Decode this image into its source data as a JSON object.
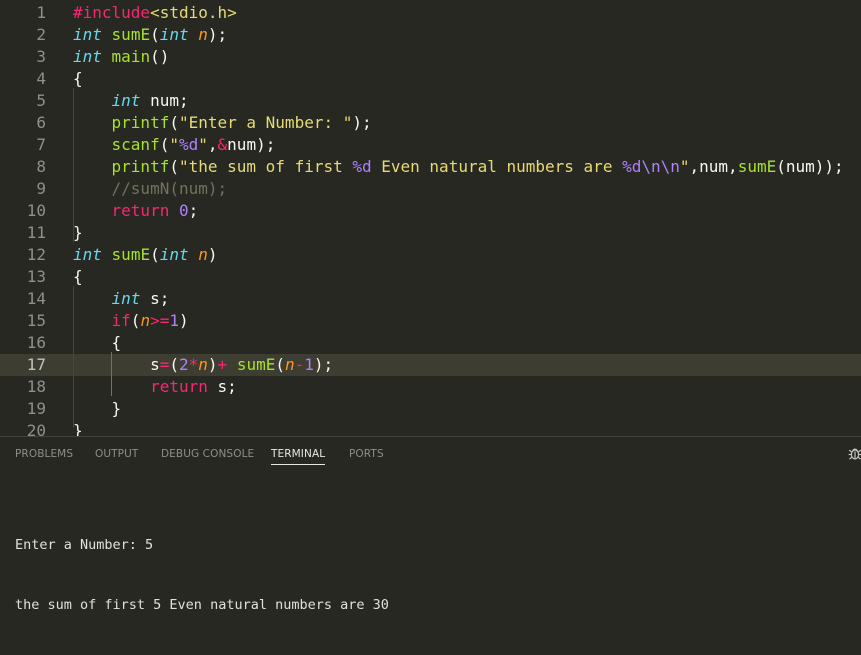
{
  "editor": {
    "active_line_number": "17",
    "lines": [
      {
        "n": "1",
        "tokens": [
          {
            "t": "#include",
            "c": "pp"
          },
          {
            "t": "<stdio.h>",
            "c": "hdr"
          }
        ]
      },
      {
        "n": "2",
        "tokens": [
          {
            "t": "int",
            "c": "type"
          },
          {
            "t": " "
          },
          {
            "t": "sumE",
            "c": "fn"
          },
          {
            "t": "("
          },
          {
            "t": "int",
            "c": "type"
          },
          {
            "t": " "
          },
          {
            "t": "n",
            "c": "param"
          },
          {
            "t": ");"
          }
        ]
      },
      {
        "n": "3",
        "tokens": [
          {
            "t": "int",
            "c": "type"
          },
          {
            "t": " "
          },
          {
            "t": "main",
            "c": "fn"
          },
          {
            "t": "()"
          }
        ]
      },
      {
        "n": "4",
        "tokens": [
          {
            "t": "{"
          }
        ]
      },
      {
        "n": "5",
        "tokens": [
          {
            "t": "    "
          },
          {
            "t": "int",
            "c": "type"
          },
          {
            "t": " num;"
          }
        ]
      },
      {
        "n": "6",
        "tokens": [
          {
            "t": "    "
          },
          {
            "t": "printf",
            "c": "fn"
          },
          {
            "t": "("
          },
          {
            "t": "\"Enter a Number: \"",
            "c": "str"
          },
          {
            "t": ");"
          }
        ]
      },
      {
        "n": "7",
        "tokens": [
          {
            "t": "    "
          },
          {
            "t": "scanf",
            "c": "fn"
          },
          {
            "t": "("
          },
          {
            "t": "\"",
            "c": "str"
          },
          {
            "t": "%d",
            "c": "fmt"
          },
          {
            "t": "\"",
            "c": "str"
          },
          {
            "t": ","
          },
          {
            "t": "&",
            "c": "op"
          },
          {
            "t": "num);"
          }
        ]
      },
      {
        "n": "8",
        "tokens": [
          {
            "t": "    "
          },
          {
            "t": "printf",
            "c": "fn"
          },
          {
            "t": "("
          },
          {
            "t": "\"the sum of first ",
            "c": "str"
          },
          {
            "t": "%d",
            "c": "fmt"
          },
          {
            "t": " Even natural numbers are ",
            "c": "str"
          },
          {
            "t": "%d\\n\\n",
            "c": "fmt"
          },
          {
            "t": "\"",
            "c": "str"
          },
          {
            "t": ",num,"
          },
          {
            "t": "sumE",
            "c": "fn"
          },
          {
            "t": "(num));"
          }
        ]
      },
      {
        "n": "9",
        "tokens": [
          {
            "t": "    "
          },
          {
            "t": "//sumN(num);",
            "c": "cmt"
          }
        ]
      },
      {
        "n": "10",
        "tokens": [
          {
            "t": "    "
          },
          {
            "t": "return",
            "c": "kw"
          },
          {
            "t": " "
          },
          {
            "t": "0",
            "c": "num"
          },
          {
            "t": ";"
          }
        ]
      },
      {
        "n": "11",
        "tokens": [
          {
            "t": "}"
          }
        ]
      },
      {
        "n": "12",
        "tokens": [
          {
            "t": "int",
            "c": "type"
          },
          {
            "t": " "
          },
          {
            "t": "sumE",
            "c": "fn"
          },
          {
            "t": "("
          },
          {
            "t": "int",
            "c": "type"
          },
          {
            "t": " "
          },
          {
            "t": "n",
            "c": "param"
          },
          {
            "t": ")"
          }
        ]
      },
      {
        "n": "13",
        "tokens": [
          {
            "t": "{"
          }
        ]
      },
      {
        "n": "14",
        "tokens": [
          {
            "t": "    "
          },
          {
            "t": "int",
            "c": "type"
          },
          {
            "t": " s;"
          }
        ]
      },
      {
        "n": "15",
        "tokens": [
          {
            "t": "    "
          },
          {
            "t": "if",
            "c": "kw"
          },
          {
            "t": "("
          },
          {
            "t": "n",
            "c": "param"
          },
          {
            "t": ">=",
            "c": "op"
          },
          {
            "t": "1",
            "c": "num"
          },
          {
            "t": ")"
          }
        ]
      },
      {
        "n": "16",
        "tokens": [
          {
            "t": "    {"
          }
        ]
      },
      {
        "n": "17",
        "tokens": [
          {
            "t": "        s"
          },
          {
            "t": "=",
            "c": "op"
          },
          {
            "t": "("
          },
          {
            "t": "2",
            "c": "num"
          },
          {
            "t": "*",
            "c": "op"
          },
          {
            "t": "n",
            "c": "param"
          },
          {
            "t": ")"
          },
          {
            "t": "+",
            "c": "op"
          },
          {
            "t": " "
          },
          {
            "t": "sumE",
            "c": "fn"
          },
          {
            "t": "("
          },
          {
            "t": "n",
            "c": "param"
          },
          {
            "t": "-",
            "c": "op"
          },
          {
            "t": "1",
            "c": "num"
          },
          {
            "t": ");"
          }
        ]
      },
      {
        "n": "18",
        "tokens": [
          {
            "t": "        "
          },
          {
            "t": "return",
            "c": "kw"
          },
          {
            "t": " s;"
          }
        ]
      },
      {
        "n": "19",
        "tokens": [
          {
            "t": "    }"
          }
        ]
      },
      {
        "n": "20",
        "tokens": [
          {
            "t": "}"
          }
        ]
      }
    ]
  },
  "panel": {
    "tabs": [
      {
        "label": "PROBLEMS",
        "active": false
      },
      {
        "label": "OUTPUT",
        "active": false
      },
      {
        "label": "DEBUG CONSOLE",
        "active": false
      },
      {
        "label": "TERMINAL",
        "active": true
      },
      {
        "label": "PORTS",
        "active": false
      }
    ],
    "right_icon": "bug-icon",
    "terminal_lines": [
      "Enter a Number: 5",
      "the sum of first 5 Even natural numbers are 30"
    ]
  },
  "colors": {
    "background": "#272822",
    "current_line": "#3e3d32",
    "keyword": "#f92672",
    "type": "#66d9ef",
    "function": "#a6e22e",
    "string": "#e6db74",
    "number": "#ae81ff",
    "parameter": "#fd971f",
    "comment": "#75715e"
  }
}
